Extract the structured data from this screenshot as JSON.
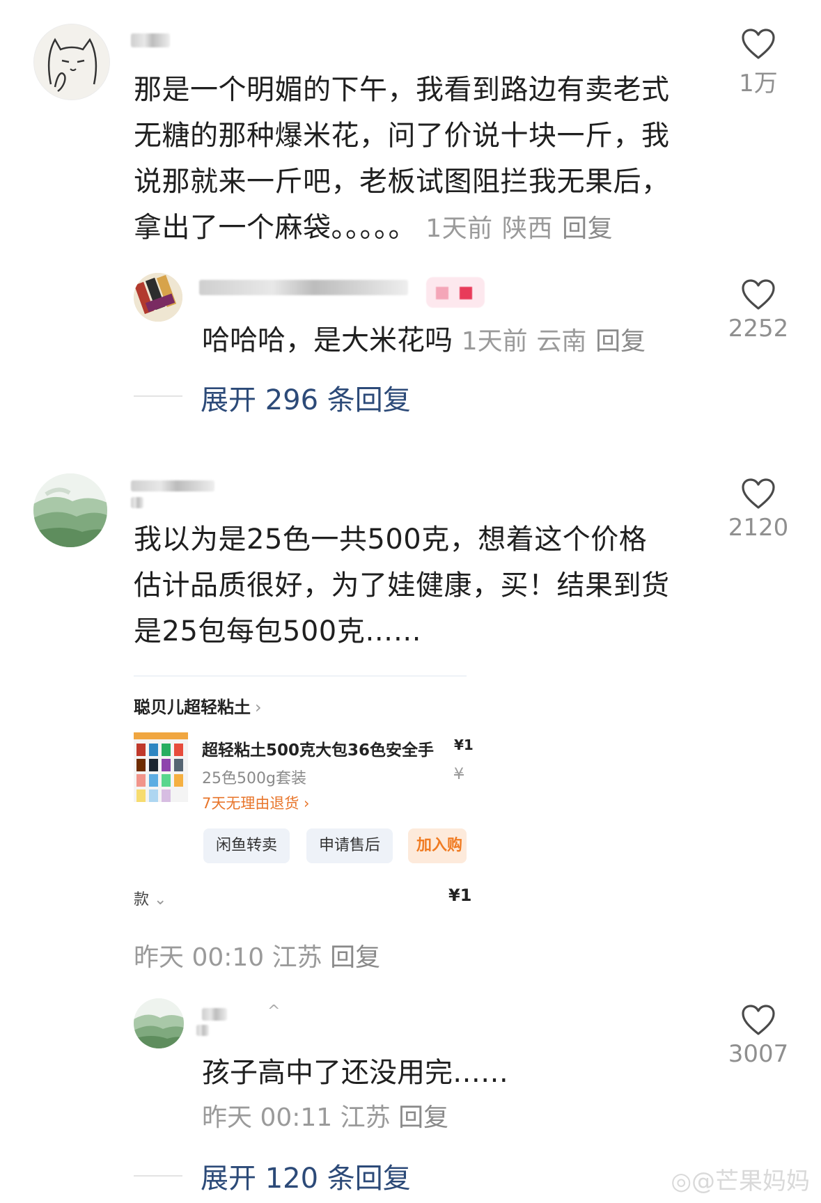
{
  "comments": [
    {
      "text_lines": [
        "那是一个明媚的下午，我看到路边有卖老式",
        "无糖的那种爆米花，问了价说十块一斤，我",
        "说那就来一斤吧，老板试图阻拦我无果后，",
        "拿出了一个麻袋。。。。。"
      ],
      "time": "1天前",
      "location": "陕西",
      "reply_label": "回复",
      "likes": "1万",
      "reply": {
        "text": "哈哈哈，是大米花吗",
        "time": "1天前",
        "location": "云南",
        "reply_label": "回复",
        "likes": "2252"
      },
      "expand": "展开 296 条回复"
    },
    {
      "text_lines": [
        "我以为是25色一共500克，想着这个价格",
        "估计品质很好，为了娃健康，买！结果到货",
        "是25包每包500克……"
      ],
      "time": "昨天 00:10",
      "location": "江苏",
      "reply_label": "回复",
      "likes": "2120",
      "card": {
        "shop": "聪贝儿超轻粘土",
        "title": "超轻粘土500克大包36色安全手",
        "spec": "25色500g套装",
        "return_policy": "7天无理由退货",
        "price_top": "¥1",
        "price_strike": "¥",
        "buttons": [
          "闲鱼转卖",
          "申请售后",
          "加入购"
        ],
        "bottom_left": "款",
        "bottom_right": "¥1"
      },
      "reply": {
        "text": "孩子高中了还没用完……",
        "time": "昨天 00:11",
        "location": "江苏",
        "reply_label": "回复",
        "likes": "3007"
      },
      "expand": "展开 120 条回复"
    }
  ],
  "watermark": "@芒果妈妈",
  "colors": {
    "accent_link": "#2c4a78",
    "meta_gray": "#9a9a9a",
    "orange": "#f07b22"
  },
  "icons": {
    "like": "heart-outline-icon",
    "chevron": "chevron-right-icon",
    "dropdown": "chevron-down-icon"
  }
}
